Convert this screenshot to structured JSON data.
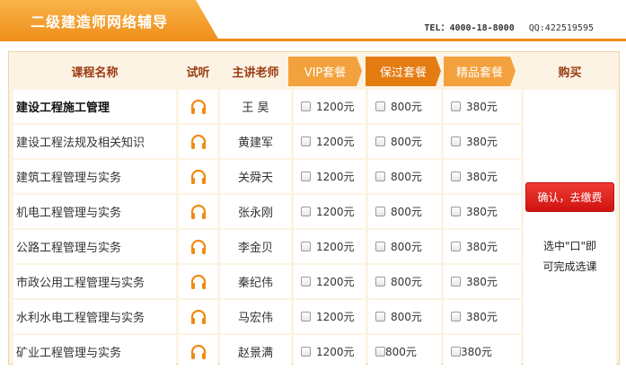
{
  "header": {
    "title": "二级建造师网络辅导",
    "tel": "TEL：4000-18-8000",
    "qq": "QQ:422519595"
  },
  "columns": {
    "course": "课程名称",
    "listen": "试听",
    "teacher": "主讲老师",
    "vip": "VIP套餐",
    "baoguo": "保过套餐",
    "jingpin": "精品套餐",
    "buy": "购买"
  },
  "rows": [
    {
      "course": "建设工程施工管理",
      "teacher": "王 昊",
      "vip": "1200元",
      "baoguo": "800元",
      "jingpin": "380元"
    },
    {
      "course": "建设工程法规及相关知识",
      "teacher": "黄建军",
      "vip": "1200元",
      "baoguo": "800元",
      "jingpin": "380元"
    },
    {
      "course": "建筑工程管理与实务",
      "teacher": "关舜天",
      "vip": "1200元",
      "baoguo": "800元",
      "jingpin": "380元"
    },
    {
      "course": "机电工程管理与实务",
      "teacher": "张永刚",
      "vip": "1200元",
      "baoguo": "800元",
      "jingpin": "380元"
    },
    {
      "course": "公路工程管理与实务",
      "teacher": "李金贝",
      "vip": "1200元",
      "baoguo": "800元",
      "jingpin": "380元"
    },
    {
      "course": "市政公用工程管理与实务",
      "teacher": "秦纪伟",
      "vip": "1200元",
      "baoguo": "800元",
      "jingpin": "380元"
    },
    {
      "course": "水利水电工程管理与实务",
      "teacher": "马宏伟",
      "vip": "1200元",
      "baoguo": "800元",
      "jingpin": "380元"
    },
    {
      "course": "矿业工程管理与实务",
      "teacher": "赵景满",
      "vip": "1200元",
      "baoguo": "800元",
      "jingpin": "380元"
    }
  ],
  "buy": {
    "button": "确认，去缴费",
    "hint_line1": "选中\"口\"即",
    "hint_line2": "可完成选课"
  },
  "icons": {
    "listen": "headphones-icon"
  },
  "colors": {
    "accent": "#ef8e1a",
    "header_text": "#9a3b12",
    "buy_button": "#d8201a"
  }
}
